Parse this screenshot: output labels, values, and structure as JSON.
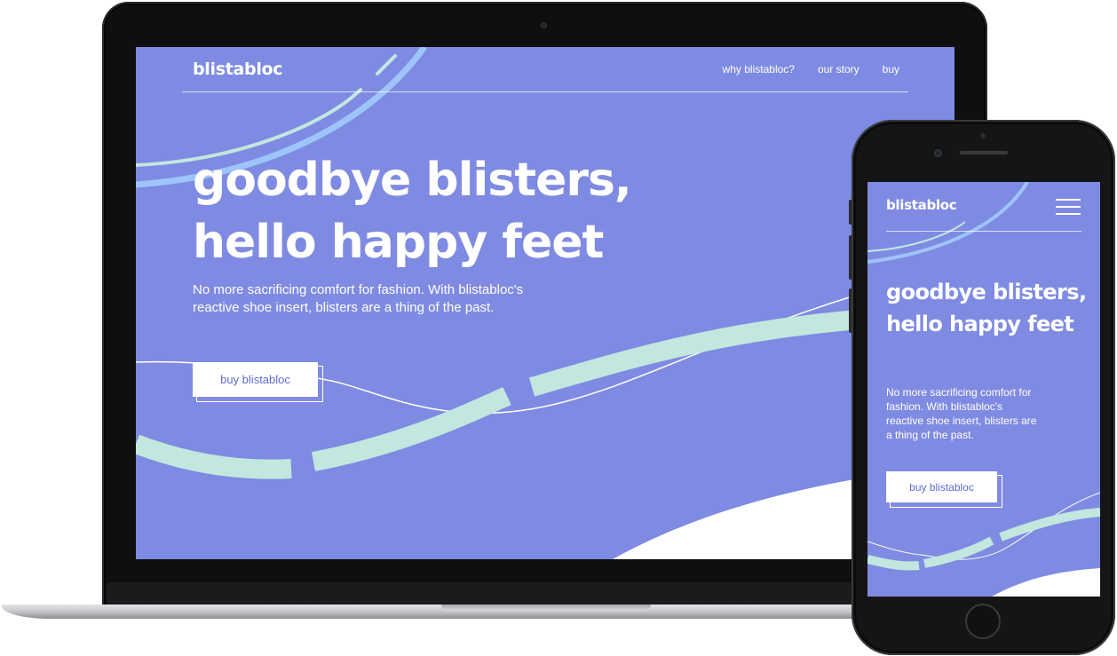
{
  "desktop": {
    "logo": "blistabloc",
    "nav": [
      "why blistabloc?",
      "our story",
      "buy"
    ],
    "headline_line1": "goodbye blisters,",
    "headline_line2": "hello happy feet",
    "subtext": "No more sacrificing comfort for fashion. With blistabloc's reactive shoe insert, blisters are a thing of the past.",
    "cta": "buy blistabloc"
  },
  "mobile": {
    "logo": "blistabloc",
    "headline": "goodbye blisters, hello happy feet",
    "subtext": "No more sacrificing comfort for fashion. With blistabloc's reactive shoe insert, blisters are a thing of the past.",
    "cta": "buy blistabloc",
    "menu_icon": "hamburger-menu-icon"
  },
  "colors": {
    "background": "#7f8be2",
    "accent_mint": "#c2e7df",
    "accent_blue": "#9ec5fb",
    "button_text": "#5f6bcf",
    "text": "#ffffff"
  }
}
